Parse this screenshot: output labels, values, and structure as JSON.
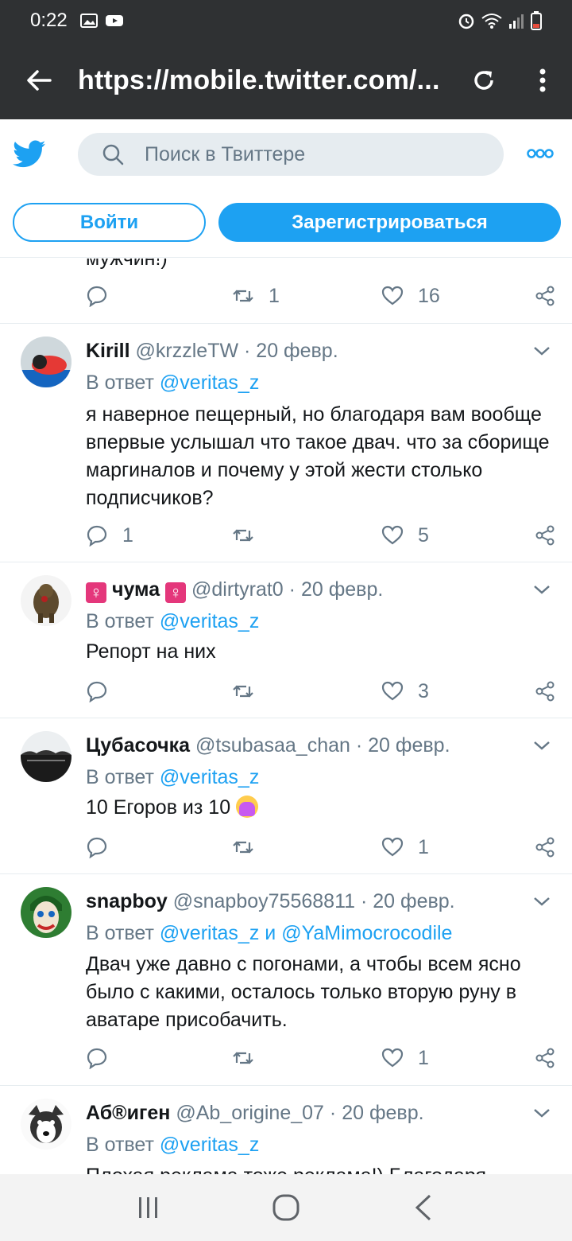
{
  "status_bar": {
    "time": "0:22"
  },
  "browser": {
    "url": "https://mobile.twitter.com/..."
  },
  "header": {
    "search_placeholder": "Поиск в Твиттере",
    "login_label": "Войти",
    "signup_label": "Зарегистрироваться"
  },
  "colors": {
    "accent": "#1da1f2",
    "muted": "#657786",
    "dark_bar": "#2f3133"
  },
  "prev_tweet": {
    "cut_text": "мужчин!)",
    "retweets": "1",
    "likes": "16"
  },
  "tweets": [
    {
      "name": "Kirill",
      "handle": "@krzzleTW",
      "sep": "·",
      "date": "20 февр.",
      "reply_prefix": "В ответ",
      "mention1": "@veritas_z",
      "text": "я наверное пещерный, но благодаря вам вообще впервые услышал что такое двач. что за сборище маргиналов и почему у этой жести столько подписчиков?",
      "replies": "1",
      "likes": "5"
    },
    {
      "name": "чума",
      "handle": "@dirtyrat0",
      "sep": "·",
      "date": "20 февр.",
      "reply_prefix": "В ответ",
      "mention1": "@veritas_z",
      "text": "Репорт на них",
      "likes": "3",
      "female_sign": "♀"
    },
    {
      "name": "Цубасочка",
      "handle": "@tsubasaa_chan",
      "sep": "·",
      "date": "20 февр.",
      "reply_prefix": "В ответ",
      "mention1": "@veritas_z",
      "text": "10 Егоров из 10",
      "likes": "1"
    },
    {
      "name": "snapboy",
      "handle": "@snapboy75568811",
      "sep": "·",
      "date": "20 февр.",
      "reply_prefix": "В ответ",
      "mention1": "@veritas_z",
      "joiner": "и",
      "mention2": "@YaMimocrocodile",
      "text": "Двач уже давно с погонами, а чтобы всем ясно было с какими, осталось только вторую руну в аватаре присобачить.",
      "likes": "1"
    },
    {
      "name": "Аб®иген",
      "handle": "@Ab_origine_07",
      "sep": "·",
      "date": "20 февр.",
      "reply_prefix": "В ответ",
      "mention1": "@veritas_z",
      "text": "Плохая реклама тоже реклама!) Благодаря"
    }
  ]
}
